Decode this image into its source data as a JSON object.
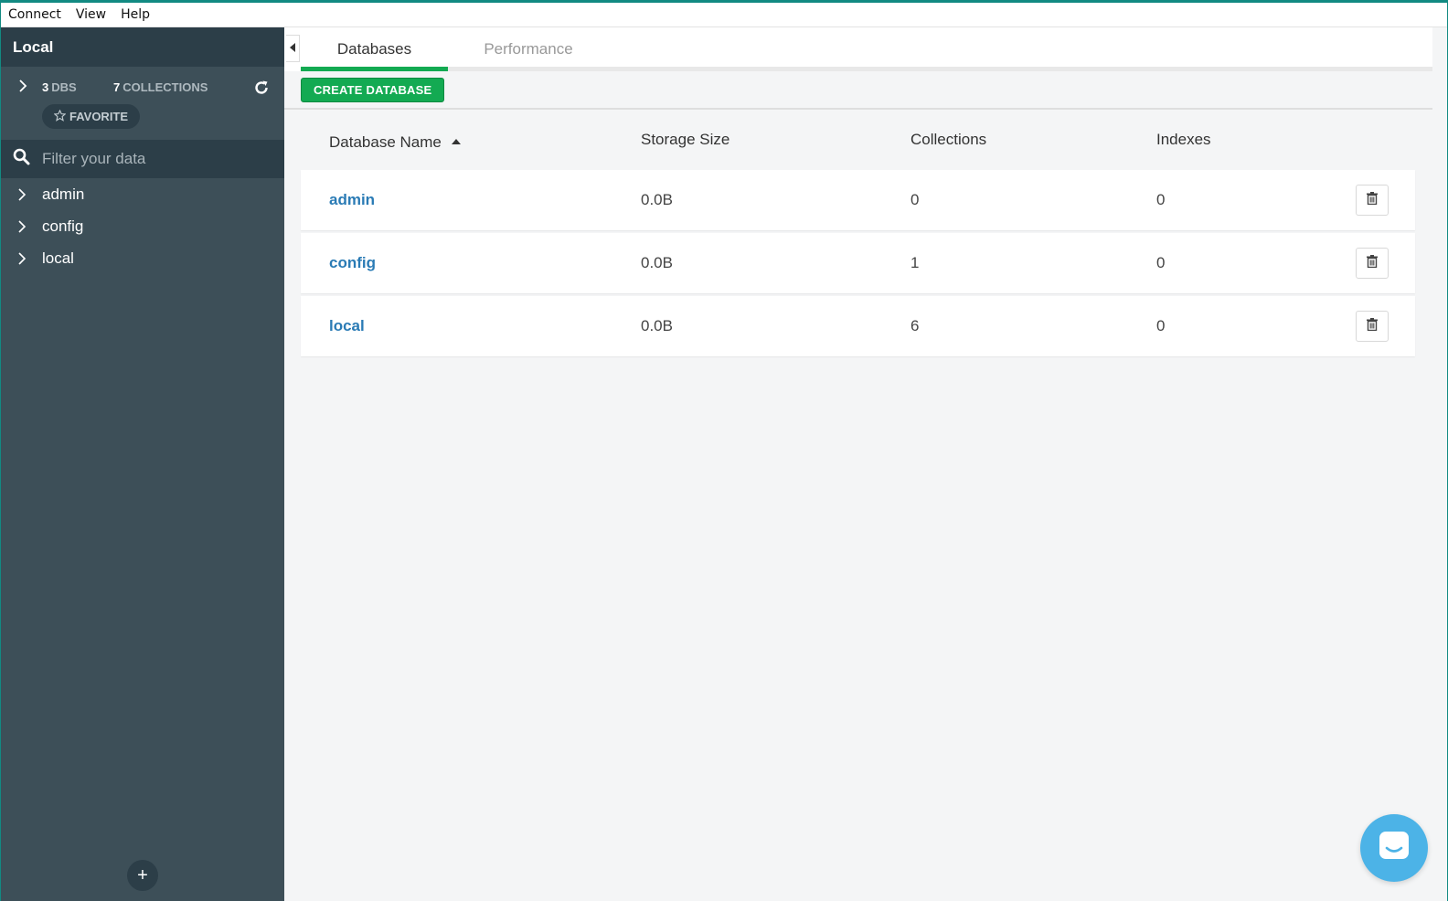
{
  "menubar": {
    "items": [
      "Connect",
      "View",
      "Help"
    ]
  },
  "sidebar": {
    "title": "Local",
    "stats": {
      "dbs_count": "3",
      "dbs_label": "DBS",
      "collections_count": "7",
      "collections_label": "COLLECTIONS"
    },
    "favorite_label": "FAVORITE",
    "filter_placeholder": "Filter your data",
    "databases": [
      "admin",
      "config",
      "local"
    ],
    "add_label": "+"
  },
  "tabs": {
    "databases": "Databases",
    "performance": "Performance"
  },
  "toolbar": {
    "create_database_label": "CREATE DATABASE"
  },
  "table": {
    "headers": {
      "name": "Database Name",
      "storage": "Storage Size",
      "collections": "Collections",
      "indexes": "Indexes"
    },
    "rows": [
      {
        "name": "admin",
        "storage": "0.0B",
        "collections": "0",
        "indexes": "0"
      },
      {
        "name": "config",
        "storage": "0.0B",
        "collections": "1",
        "indexes": "0"
      },
      {
        "name": "local",
        "storage": "0.0B",
        "collections": "6",
        "indexes": "0"
      }
    ]
  },
  "icons": {
    "refresh": "refresh-icon",
    "search": "search-icon",
    "star": "star-icon",
    "trash": "trash-icon",
    "chat": "chat-icon",
    "chevron": "chevron-right-icon",
    "sort": "sort-asc-icon",
    "collapse": "collapse-left-icon"
  },
  "colors": {
    "accent": "#13aa52",
    "sidebar_bg": "#3d4f58",
    "sidebar_dark": "#2c3e48",
    "link": "#2a7bb5",
    "chat": "#4cb3e7",
    "window_border": "#128a82"
  }
}
